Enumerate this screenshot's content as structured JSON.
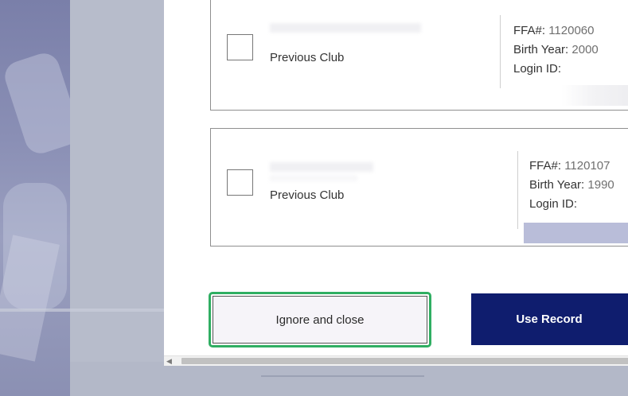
{
  "records": [
    {
      "club": "Previous Club",
      "ffa_label": "FFA#:",
      "ffa_value": "1120060",
      "birth_label": "Birth Year:",
      "birth_value": "2000",
      "login_label": "Login ID:"
    },
    {
      "club": "Previous Club",
      "ffa_label": "FFA#:",
      "ffa_value": "1120107",
      "birth_label": "Birth Year:",
      "birth_value": "1990",
      "login_label": "Login ID:"
    }
  ],
  "actions": {
    "ignore_label": "Ignore and close",
    "use_label": "Use Record"
  },
  "scrollbar": {
    "left_arrow": "◀"
  },
  "colors": {
    "primary_button": "#0f1d6e",
    "focus_ring": "#2fae62",
    "backdrop": "#b5bbcb"
  }
}
